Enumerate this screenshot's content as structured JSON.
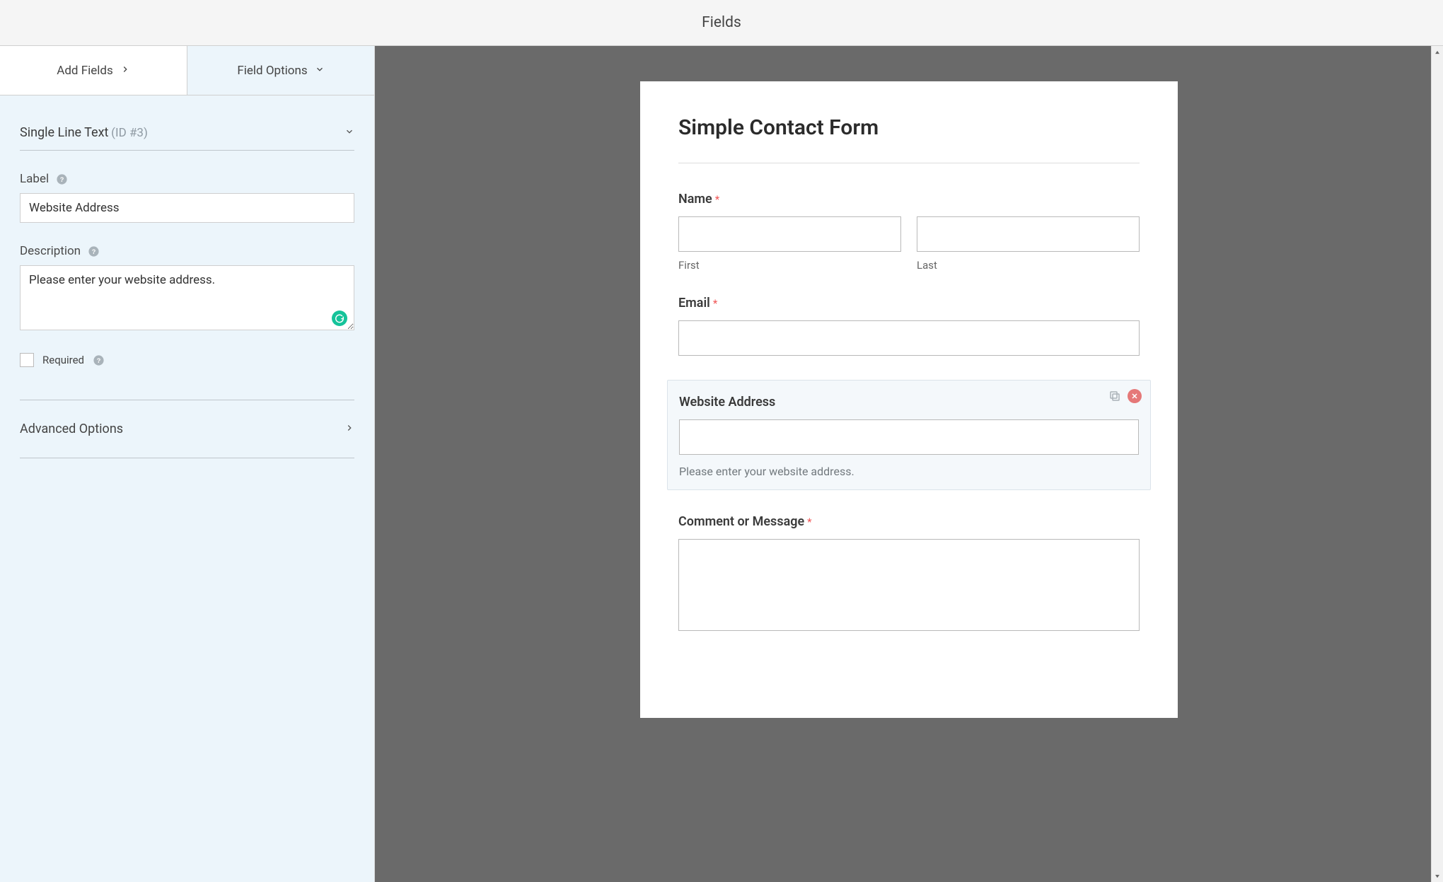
{
  "topbar": {
    "title": "Fields"
  },
  "tabs": {
    "add": "Add Fields",
    "options": "Field Options"
  },
  "field_header": {
    "type": "Single Line Text",
    "id": "(ID #3)"
  },
  "labels": {
    "label": "Label",
    "description": "Description",
    "required": "Required",
    "advanced": "Advanced Options"
  },
  "values": {
    "label": "Website Address",
    "description": "Please enter your website address.",
    "required_checked": false
  },
  "preview": {
    "form_title": "Simple Contact Form",
    "required_marker": "*",
    "name": {
      "label": "Name",
      "first": "First",
      "last": "Last"
    },
    "email": {
      "label": "Email"
    },
    "website": {
      "label": "Website Address",
      "desc": "Please enter your website address."
    },
    "comment": {
      "label": "Comment or Message"
    }
  }
}
